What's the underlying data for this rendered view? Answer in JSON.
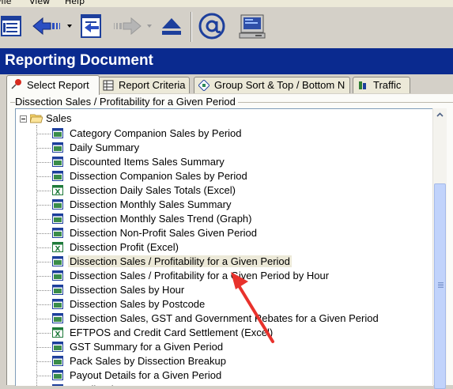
{
  "menu": {
    "file": "File",
    "view": "View",
    "help": "Help"
  },
  "toolbar": {
    "buttons": [
      "tree-view-icon",
      "back-icon",
      "document-import-icon",
      "forward-icon",
      "eject-icon",
      "email-icon",
      "computer-icon"
    ]
  },
  "title": "Reporting Document",
  "tabs": [
    {
      "label": "Select Report",
      "icon": "pushpin-icon"
    },
    {
      "label": "Report Criteria",
      "icon": "grid-icon"
    },
    {
      "label": "Group Sort & Top / Bottom N",
      "icon": "sort-icon"
    },
    {
      "label": "Traffic",
      "icon": "traffic-icon"
    }
  ],
  "group_label": "Dissection Sales / Profitability for a Given Period",
  "tree": {
    "root": "Sales",
    "items": [
      {
        "label": "Category Companion Sales by Period",
        "icon": "report-icon"
      },
      {
        "label": "Daily Summary",
        "icon": "report-icon"
      },
      {
        "label": "Discounted Items Sales Summary",
        "icon": "report-icon"
      },
      {
        "label": "Dissection Companion Sales by Period",
        "icon": "report-icon"
      },
      {
        "label": "Dissection Daily Sales Totals (Excel)",
        "icon": "excel-icon"
      },
      {
        "label": "Dissection Monthly Sales Summary",
        "icon": "report-icon"
      },
      {
        "label": "Dissection Monthly Sales Trend (Graph)",
        "icon": "report-icon"
      },
      {
        "label": "Dissection Non-Profit Sales Given Period",
        "icon": "report-icon"
      },
      {
        "label": "Dissection Profit (Excel)",
        "icon": "excel-icon"
      },
      {
        "label": "Dissection Sales / Profitability for a Given Period",
        "icon": "report-icon",
        "selected": true
      },
      {
        "label": "Dissection Sales / Profitability for a Given Period by Hour",
        "icon": "report-icon"
      },
      {
        "label": "Dissection Sales by Hour",
        "icon": "report-icon"
      },
      {
        "label": "Dissection Sales by Postcode",
        "icon": "report-icon"
      },
      {
        "label": "Dissection Sales, GST and Government Rebates for a Given Period",
        "icon": "report-icon"
      },
      {
        "label": "EFTPOS and Credit Card Settlement (Excel)",
        "icon": "excel-icon"
      },
      {
        "label": "GST Summary for a Given Period",
        "icon": "report-icon"
      },
      {
        "label": "Pack Sales by Dissection Breakup",
        "icon": "report-icon"
      },
      {
        "label": "Payout Details for a Given Period",
        "icon": "report-icon"
      },
      {
        "label": "Retail Sales By Tax",
        "icon": "report-icon"
      }
    ]
  },
  "colors": {
    "titlebar": "#0a2a8f",
    "annotation_arrow": "#e8322c"
  }
}
